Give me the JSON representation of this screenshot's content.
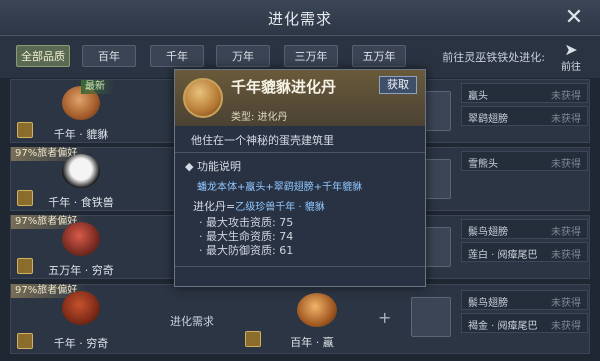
{
  "window": {
    "title": "进化需求"
  },
  "filters": [
    {
      "label": "全部品质",
      "active": true
    },
    {
      "label": "百年",
      "active": false
    },
    {
      "label": "千年",
      "active": false
    },
    {
      "label": "万年",
      "active": false
    },
    {
      "label": "三万年",
      "active": false
    },
    {
      "label": "五万年",
      "active": false
    }
  ],
  "goto": {
    "text": "前往灵巫铁铁处进化:",
    "button_label": "前往"
  },
  "rows": [
    {
      "tag": "最新",
      "name": "千年 · 貔貅",
      "materials": [
        {
          "name": "蠃头",
          "status": "未获得"
        },
        {
          "name": "翠鹞翅膀",
          "status": "未获得"
        }
      ]
    },
    {
      "tag": "97%旅者偏好",
      "name": "千年 · 食铁兽",
      "materials": [
        {
          "name": "雪熊头",
          "status": "未获得"
        }
      ]
    },
    {
      "tag": "97%旅者偏好",
      "name": "五万年 · 穷奇",
      "materials": [
        {
          "name": "鬃鸟翅膀",
          "status": "未获得"
        },
        {
          "name": "莲白 · 阋瘴尾巴",
          "status": "未获得"
        }
      ]
    },
    {
      "tag": "97%旅者偏好",
      "name": "千年 · 穷奇",
      "req_label": "进化需求",
      "result_name": "百年 · 蠃",
      "materials": [
        {
          "name": "鬃鸟翅膀",
          "status": "未获得"
        },
        {
          "name": "褐金 · 阋瘴尾巴",
          "status": "未获得"
        }
      ]
    }
  ],
  "popup": {
    "title": "千年貔貅进化丹",
    "obtain_label": "获取",
    "type_text": "类型: 进化丹",
    "description": "他住在一个神秘的蛋壳建筑里",
    "section_title": "◆ 功能说明",
    "recipe": "蟠龙本体+蠃头+翠鹞翅膀+千年貔貅",
    "evo_prefix": "进化丹=",
    "evo_target": "乙级珍兽千年 · 貔貅",
    "stats": [
      "· 最大攻击资质: 75",
      "· 最大生命资质: 74",
      "· 最大防御资质: 61"
    ]
  },
  "colors": {
    "accent_blue": "#8fc7ff",
    "gold": "#d1b062"
  },
  "icons": [
    "close-icon",
    "paper-plane-icon",
    "crown-badge-icon"
  ]
}
